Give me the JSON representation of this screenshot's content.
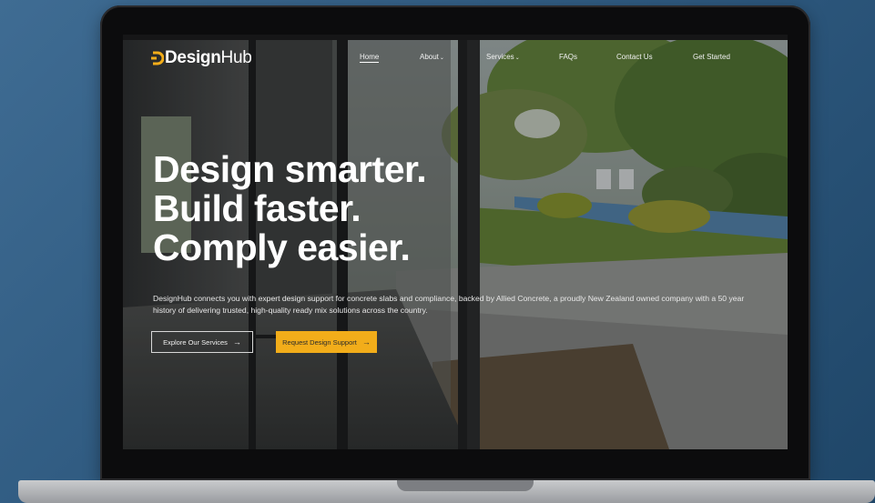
{
  "logo": {
    "design": "Design",
    "hub": "Hub"
  },
  "nav": {
    "items": [
      {
        "label": "Home",
        "has_dropdown": false,
        "active": true
      },
      {
        "label": "About",
        "has_dropdown": true,
        "active": false
      },
      {
        "label": "Services",
        "has_dropdown": true,
        "active": false
      },
      {
        "label": "FAQs",
        "has_dropdown": false,
        "active": false
      },
      {
        "label": "Contact Us",
        "has_dropdown": false,
        "active": false
      },
      {
        "label": "Get Started",
        "has_dropdown": false,
        "active": false
      }
    ],
    "caret": "⌄"
  },
  "hero": {
    "headline": [
      "Design smarter.",
      "Build faster.",
      "Comply easier."
    ],
    "description": "DesignHub connects you with expert design support for concrete slabs and compliance, backed by Allied Concrete, a proudly New Zealand owned company with a 50 year history of delivering trusted, high-quality ready mix solutions across the country.",
    "secondary_button": "Explore Our Services",
    "primary_button": "Request Design Support",
    "arrow": "→"
  },
  "colors": {
    "accent": "#f2ad1a",
    "background": "#2f5a80",
    "text": "#ffffff"
  },
  "icons": [
    "logo-mark-icon",
    "chevron-down-icon",
    "arrow-right-icon"
  ]
}
